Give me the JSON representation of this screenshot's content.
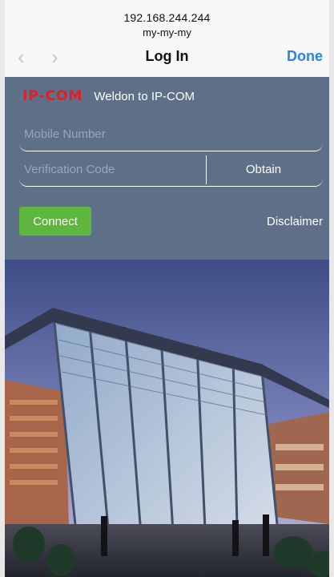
{
  "browser": {
    "url": "192.168.244.244",
    "subtitle": "my-my-my",
    "back_icon": "chevron-left-icon",
    "forward_icon": "chevron-right-icon",
    "page_title": "Log In",
    "done_label": "Done"
  },
  "login": {
    "brand_logo": "IP-COM",
    "welcome_text": "Weldon to IP-COM",
    "mobile_placeholder": "Mobile Number",
    "code_placeholder": "Verification Code",
    "obtain_label": "Obtain",
    "connect_label": "Connect",
    "disclaimer_label": "Disclaimer"
  },
  "colors": {
    "panel": "#5e6f88",
    "brand_red": "#e51c24",
    "connect_green": "#5fb63e",
    "done_blue": "#2a83e0"
  }
}
